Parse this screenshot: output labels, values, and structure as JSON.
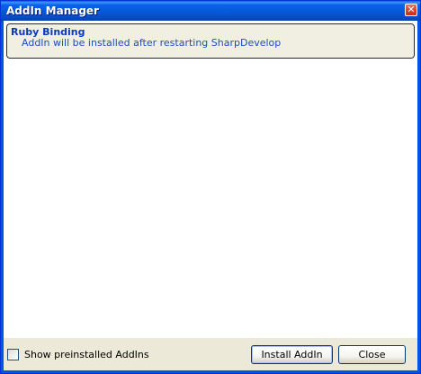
{
  "window": {
    "title": "AddIn Manager",
    "close_glyph": "✕"
  },
  "addins": [
    {
      "name": "Ruby Binding",
      "status": "AddIn will be installed after restarting SharpDevelop"
    }
  ],
  "options": {
    "show_preinstalled_label": "Show preinstalled AddIns",
    "show_preinstalled_checked": false
  },
  "buttons": {
    "install_label": "Install AddIn",
    "close_label": "Close"
  },
  "colors": {
    "title_bar": "#0a63e8",
    "addin_name": "#0a3ab8",
    "addin_status": "#1a4fc0",
    "dialog_background": "#ece9d8"
  }
}
